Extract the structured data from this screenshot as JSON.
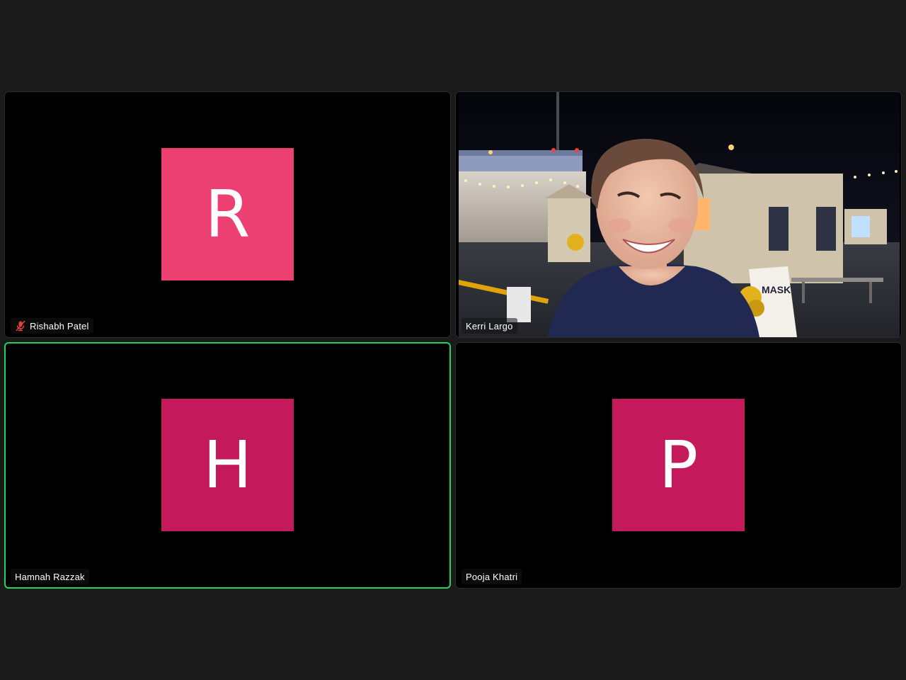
{
  "participants": [
    {
      "name": "Rishabh Patel",
      "initial": "R",
      "avatar_color": "#ec4073",
      "muted": true,
      "video_on": false,
      "active_speaker": false
    },
    {
      "name": "Kerri Largo",
      "initial": "",
      "avatar_color": "",
      "muted": false,
      "video_on": true,
      "active_speaker": false
    },
    {
      "name": "Hamnah Razzak",
      "initial": "H",
      "avatar_color": "#c4195a",
      "muted": false,
      "video_on": false,
      "active_speaker": true
    },
    {
      "name": "Pooja Khatri",
      "initial": "P",
      "avatar_color": "#c4195a",
      "muted": false,
      "video_on": false,
      "active_speaker": false
    }
  ],
  "colors": {
    "background": "#1a1a1a",
    "tile": "#000000",
    "active_speaker_border": "#23d160",
    "muted_icon": "#e0403f"
  },
  "video_scene": {
    "sign_text": "MASK"
  }
}
